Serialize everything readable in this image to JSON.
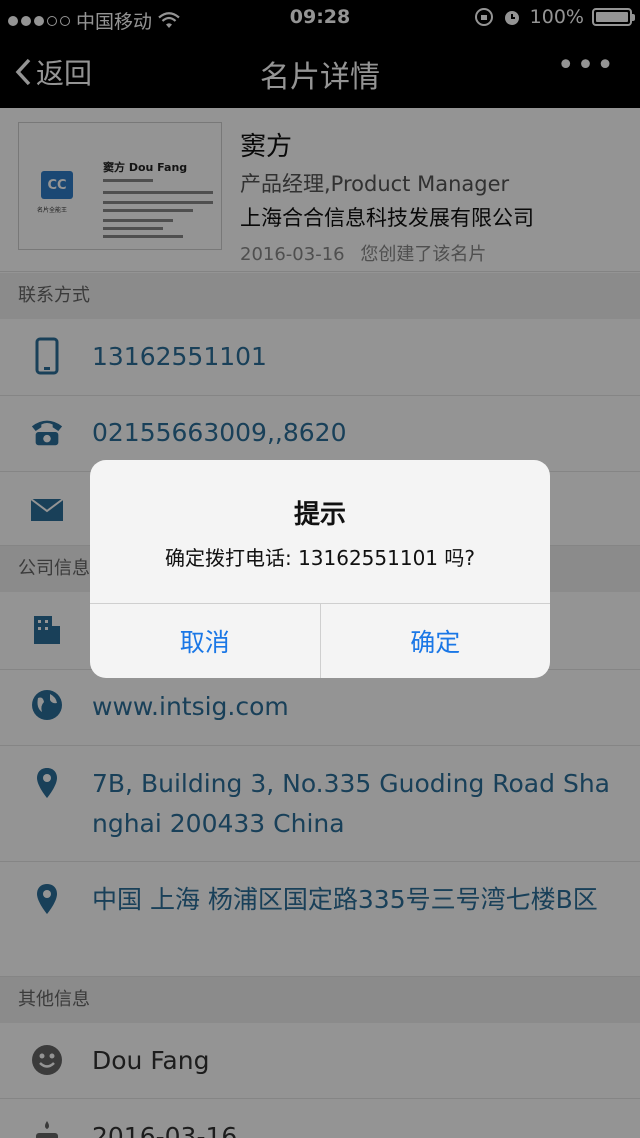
{
  "status": {
    "carrier": "中国移动",
    "time": "09:28",
    "battery": "100%"
  },
  "nav": {
    "back": "返回",
    "title": "名片详情",
    "more": "•••"
  },
  "card": {
    "thumb_name": "窦方 Dou Fang",
    "thumb_logo": "CC",
    "thumb_logo_label": "名片全能王",
    "name": "窦方",
    "title": "产品经理,Product Manager",
    "company": "上海合合信息科技发展有限公司",
    "date": "2016-03-16",
    "created_note": "您创建了该名片"
  },
  "sections": {
    "contact": "联系方式",
    "company": "公司信息",
    "other": "其他信息"
  },
  "contact": {
    "mobile": "13162551101",
    "phone": "02155663009,,8620"
  },
  "company": {
    "website": "www.intsig.com",
    "address_en": "7B, Building 3, No.335 Guoding Road Shanghai 200433 China",
    "address_cn": "中国 上海 杨浦区国定路335号三号湾七楼B区"
  },
  "other": {
    "english_name": "Dou Fang",
    "birthday": "2016-03-16"
  },
  "dialog": {
    "title": "提示",
    "message": "确定拨打电话: 13162551101 吗?",
    "cancel": "取消",
    "confirm": "确定"
  },
  "colors": {
    "link": "#2b6e99",
    "icon": "#2b6e99",
    "dialog_button": "#1a77e6",
    "nav_bg": "#000000"
  },
  "icons": [
    "chevron-left-icon",
    "more-icon",
    "mobile-icon",
    "phone-icon",
    "mail-icon",
    "building-icon",
    "globe-icon",
    "location-icon",
    "smiley-icon",
    "cake-icon",
    "signal-icon",
    "wifi-icon",
    "lock-rotation-icon",
    "alarm-icon",
    "battery-icon"
  ]
}
